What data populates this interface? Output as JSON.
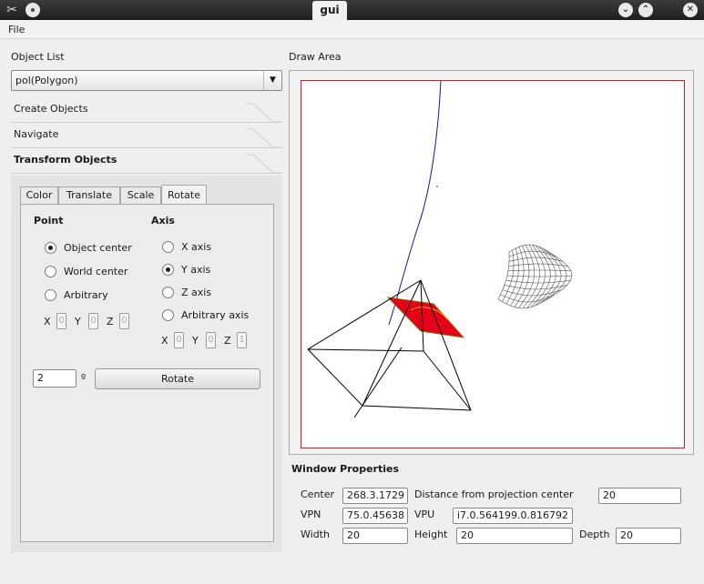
{
  "window": {
    "title": "gui"
  },
  "menubar": {
    "file": "File"
  },
  "object_list": {
    "label": "Object List",
    "selected": "pol(Polygon)"
  },
  "toolbox": {
    "create": "Create Objects",
    "navigate": "Navigate",
    "transform": "Transform Objects"
  },
  "tabs": {
    "color": "Color",
    "translate": "Translate",
    "scale": "Scale",
    "rotate": "Rotate"
  },
  "rotate_tab": {
    "point_header": "Point",
    "axis_header": "Axis",
    "point_options": [
      "Object center",
      "World center",
      "Arbitrary"
    ],
    "axis_options": [
      "X axis",
      "Y axis",
      "Z axis",
      "Arbitrary axis"
    ],
    "selected_point": "Object center",
    "selected_axis": "Y axis",
    "x": "X",
    "y": "Y",
    "z": "Z",
    "point_x": "0",
    "point_y": "0",
    "point_z": "0",
    "axis_x": "0",
    "axis_y": "0",
    "axis_z": "1",
    "angle": "2",
    "degree_symbol": "º",
    "rotate_button": "Rotate"
  },
  "draw_area": {
    "label": "Draw Area"
  },
  "window_properties": {
    "header": "Window Properties",
    "center_label": "Center",
    "center_value": "268.3.1729",
    "distance_label": "Distance from projection center",
    "distance_value": "20",
    "vpn_label": "VPN",
    "vpn_value": "75.0.45638",
    "vpu_label": "VPU",
    "vpu_value": "i7.0.564199.0.816792",
    "width_label": "Width",
    "width_value": "20",
    "height_label": "Height",
    "height_value": "20",
    "depth_label": "Depth",
    "depth_value": "20"
  },
  "colors": {
    "polygon_fill": "#e6001a",
    "canvas_border": "#c81e1e",
    "curve": "#1a1a9a"
  }
}
